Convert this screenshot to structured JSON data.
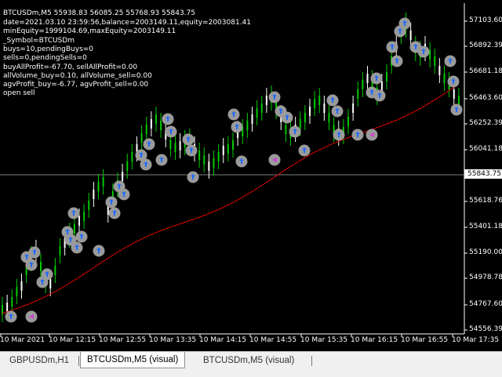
{
  "window": {
    "symbol_line": "BTCUSDm,M5  55938.83 56085.25 55768.93 55843.75",
    "info_lines": [
      "date=2021.03.10 23:59:56,balance=2003149.11,equity=2003081.41",
      "minEquity=1999104.69,maxEquity=2003149.11",
      "_Symbol=BTCUSDm",
      "buys=10,pendingBuys=0",
      "sells=0,pendingSells=0",
      "buyAllProfit=-67.70, sellAllProfit=0.00",
      "allVolume_buy=0.10, allVolume_sell=0.00",
      "agvProfit_buy=-6.77, agvProfit_sell=0.00",
      "open sell"
    ]
  },
  "price_axis": {
    "labels": [
      "57103.60",
      "56892.39",
      "56681.18",
      "56463.60",
      "56252.39",
      "56041.18",
      "55618.76",
      "55401.18",
      "55190.00",
      "54978.78",
      "54767.60",
      "54556.39"
    ],
    "current_price": "55843.75"
  },
  "time_axis": {
    "labels": [
      "10 Mar 2021",
      "10 Mar 12:15",
      "10 Mar 12:55",
      "10 Mar 13:35",
      "10 Mar 14:15",
      "10 Mar 14:55",
      "10 Mar 15:35",
      "10 Mar 16:15",
      "10 Mar 16:55",
      "10 Mar 17:35"
    ]
  },
  "tabs": [
    {
      "label": "GBPUSDm,H1",
      "active": false
    },
    {
      "label": "BTCUSDm,M5 (visual)",
      "active": true
    },
    {
      "label": "BTCUSDm,M5 (visual)",
      "active": false
    }
  ],
  "colors": {
    "bull_candle": "#00cc00",
    "bear_candle": "#ffffff",
    "moving_average": "#e00000",
    "trade_marker": "#9a9a9a",
    "buy_arrow": "#1e6bff",
    "sell_arrow": "#d040d0"
  }
}
